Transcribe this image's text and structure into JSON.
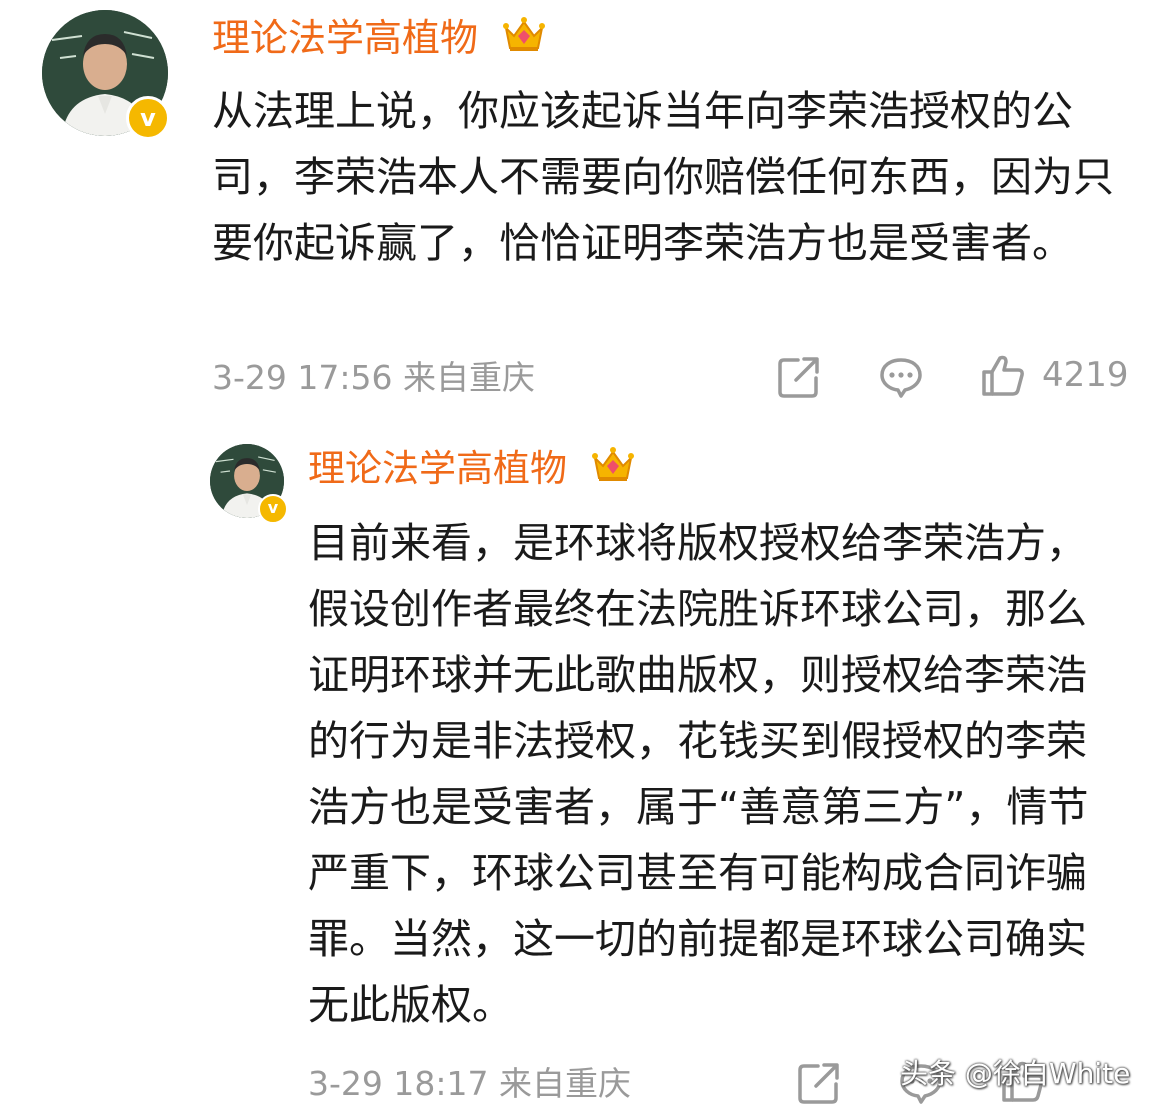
{
  "comments": [
    {
      "author": "理论法学高植物",
      "badge_icon": "crown-gem-icon",
      "verified_mark": "v",
      "text": "从法理上说，你应该起诉当年向李荣浩授权的公司，李荣浩本人不需要向你赔偿任何东西，因为只要你起诉赢了，恰恰证明李荣浩方也是受害者。",
      "timestamp": "3-29 17:56",
      "location": "来自重庆",
      "meta": "3-29 17:56  来自重庆",
      "like_count": "4219"
    },
    {
      "author": "理论法学高植物",
      "badge_icon": "crown-gem-icon",
      "verified_mark": "v",
      "text": "目前来看，是环球将版权授权给李荣浩方，假设创作者最终在法院胜诉环球公司，那么证明环球并无此歌曲版权，则授权给李荣浩的行为是非法授权，花钱买到假授权的李荣浩方也是受害者，属于“善意第三方”，情节严重下，环球公司甚至有可能构成合同诈骗罪。当然，这一切的前提都是环球公司确实无此版权。",
      "timestamp": "3-29 18:17",
      "location": "来自重庆",
      "meta": "3-29 18:17  来自重庆"
    }
  ],
  "watermark": "头条 @徐白White",
  "colors": {
    "author_name": "#f06a18",
    "meta_text": "#9a9a9a",
    "body_text": "#1a1a1a",
    "verified_badge": "#f5b800"
  }
}
